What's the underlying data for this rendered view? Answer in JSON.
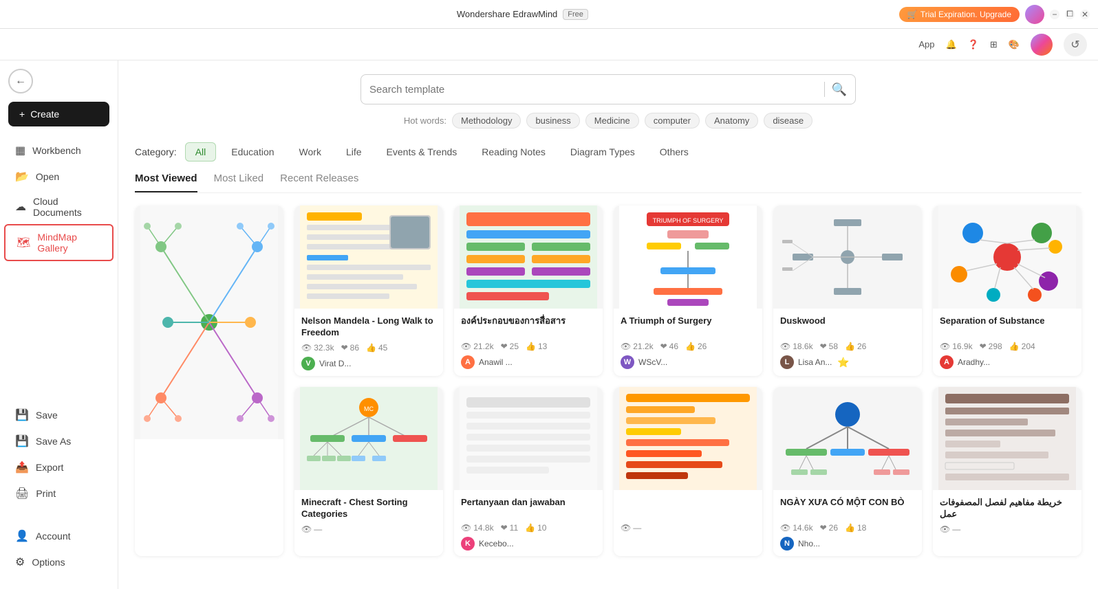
{
  "titlebar": {
    "app_name": "Wondershare EdrawMind",
    "badge": "Free",
    "trial_label": "Trial Expiration. Upgrade",
    "toolbar_app": "App",
    "min_label": "−",
    "max_label": "⧠",
    "close_label": "✕"
  },
  "sidebar": {
    "back_label": "←",
    "create_label": "+ Create",
    "items": [
      {
        "id": "workbench",
        "label": "Workbench",
        "icon": "⬛"
      },
      {
        "id": "open",
        "label": "Open",
        "icon": "📁"
      },
      {
        "id": "cloud",
        "label": "Cloud Documents",
        "icon": "☁️"
      },
      {
        "id": "gallery",
        "label": "MindMap Gallery",
        "icon": "🗺"
      }
    ],
    "bottom_items": [
      {
        "id": "account",
        "label": "Account",
        "icon": "👤"
      },
      {
        "id": "options",
        "label": "Options",
        "icon": "⚙️"
      }
    ]
  },
  "search": {
    "placeholder": "Search template",
    "hot_words_label": "Hot words:",
    "tags": [
      "Methodology",
      "business",
      "Medicine",
      "computer",
      "Anatomy",
      "disease"
    ]
  },
  "categories": {
    "label": "Category:",
    "items": [
      {
        "id": "all",
        "label": "All",
        "active": true
      },
      {
        "id": "education",
        "label": "Education"
      },
      {
        "id": "work",
        "label": "Work"
      },
      {
        "id": "life",
        "label": "Life"
      },
      {
        "id": "events",
        "label": "Events & Trends"
      },
      {
        "id": "reading",
        "label": "Reading Notes"
      },
      {
        "id": "diagram",
        "label": "Diagram Types"
      },
      {
        "id": "others",
        "label": "Others"
      }
    ]
  },
  "tabs": [
    {
      "id": "most_viewed",
      "label": "Most Viewed",
      "active": true
    },
    {
      "id": "most_liked",
      "label": "Most Liked",
      "active": false
    },
    {
      "id": "recent",
      "label": "Recent Releases",
      "active": false
    }
  ],
  "cards": [
    {
      "id": "card1",
      "title": "",
      "stats": {
        "views": "",
        "likes": "",
        "dislikes": ""
      },
      "author": "",
      "author_color": "#4CAF50",
      "large": true,
      "thumb_type": "mindmap_green"
    },
    {
      "id": "card2",
      "title": "Nelson Mandela - Long Walk to Freedom",
      "stats": {
        "views": "32.3k",
        "likes": "86",
        "dislikes": "45"
      },
      "author": "Virat D...",
      "author_color": "#4CAF50",
      "large": false,
      "thumb_type": "book_notes"
    },
    {
      "id": "card3",
      "title": "องค์ประกอบของการสื่อสาร",
      "stats": {
        "views": "21.2k",
        "likes": "25",
        "dislikes": "13"
      },
      "author": "Anawil ...",
      "author_color": "#FF7043",
      "large": false,
      "thumb_type": "colorful_bars"
    },
    {
      "id": "card4",
      "title": "A Triumph of Surgery",
      "stats": {
        "views": "21.2k",
        "likes": "46",
        "dislikes": "26"
      },
      "author": "WScV...",
      "author_color": "#7E57C2",
      "large": false,
      "thumb_type": "surgery",
      "badge": false
    },
    {
      "id": "card5",
      "title": "Duskwood",
      "stats": {
        "views": "18.6k",
        "likes": "58",
        "dislikes": "26"
      },
      "author": "Lisa An...",
      "author_color": "#795548",
      "large": false,
      "thumb_type": "tree_map",
      "has_gold": true
    },
    {
      "id": "card6",
      "title": "Separation of Substance",
      "stats": {
        "views": "16.9k",
        "likes": "298",
        "dislikes": "204"
      },
      "author": "Aradhy...",
      "author_color": "#E53935",
      "large": false,
      "thumb_type": "bubbles"
    },
    {
      "id": "card7",
      "title": "Minecraft - Chest Sorting Categories",
      "stats": {
        "views": "",
        "likes": "",
        "dislikes": ""
      },
      "author": "",
      "author_color": "#FF8F00",
      "large": false,
      "thumb_type": "minecraft"
    },
    {
      "id": "card8",
      "title": "Pertanyaan dan jawaban",
      "stats": {
        "views": "14.8k",
        "likes": "11",
        "dislikes": "10"
      },
      "author": "Kecebo...",
      "author_color": "#EC407A",
      "large": false,
      "thumb_type": "qa_map"
    },
    {
      "id": "card9",
      "title": "",
      "stats": {
        "views": "",
        "likes": "",
        "dislikes": ""
      },
      "author": "",
      "author_color": "#FF6F00",
      "large": false,
      "thumb_type": "orange_mind"
    },
    {
      "id": "card10",
      "title": "NGÀY XƯA CÓ MỘT CON BÒ",
      "stats": {
        "views": "14.6k",
        "likes": "26",
        "dislikes": "18"
      },
      "author": "Nho...",
      "author_color": "#1565C0",
      "large": false,
      "thumb_type": "colorful_mind"
    },
    {
      "id": "card11",
      "title": "خريطة مفاهيم لفصل المصفوفات عمل",
      "stats": {
        "views": "",
        "likes": "",
        "dislikes": ""
      },
      "author": "",
      "author_color": "#6D4C41",
      "large": false,
      "thumb_type": "arabic_map"
    }
  ],
  "colors": {
    "accent": "#2d8a2d",
    "sidebar_active_border": "#e84b4b",
    "title_bar_bg": "#ffffff"
  }
}
